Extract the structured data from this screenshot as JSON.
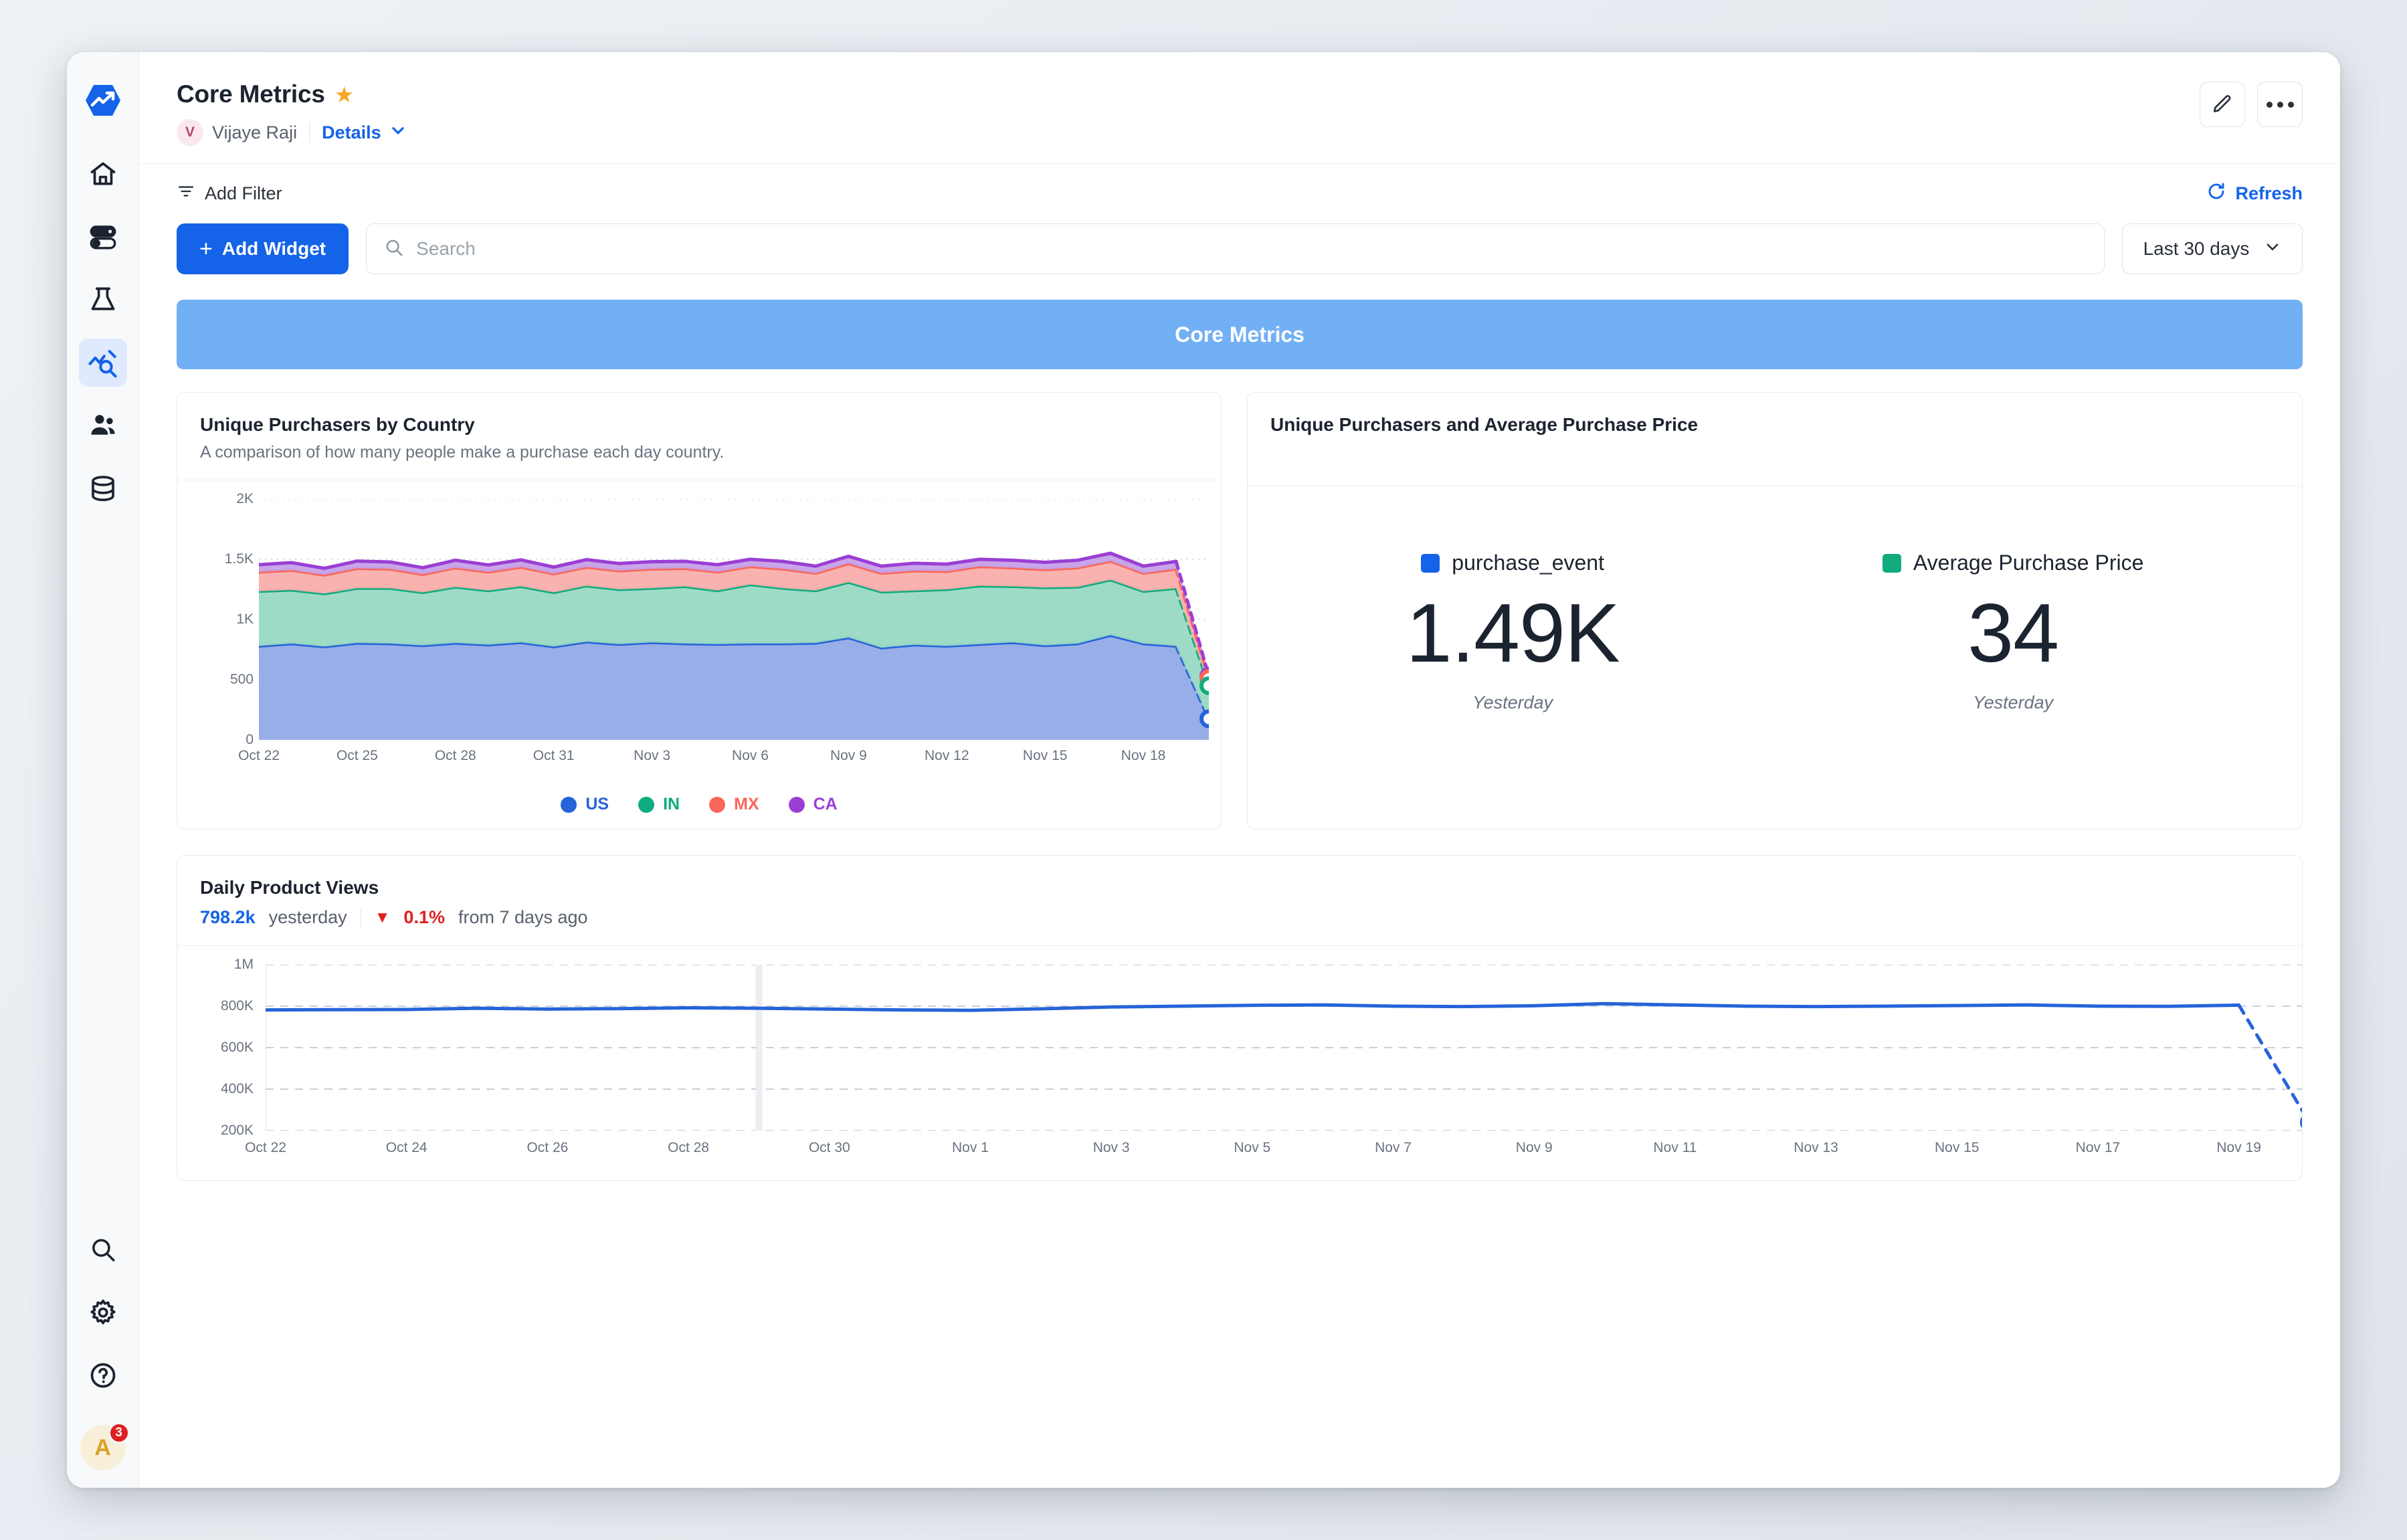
{
  "sidebar": {
    "items": [
      {
        "name": "logo",
        "icon": "statsig-logo-icon",
        "label": "Statsig"
      },
      {
        "name": "home",
        "icon": "home-icon",
        "label": "Home"
      },
      {
        "name": "feature-gates",
        "icon": "toggles-icon",
        "label": "Feature Gates"
      },
      {
        "name": "experiments",
        "icon": "flask-icon",
        "label": "Experiments"
      },
      {
        "name": "metrics",
        "icon": "analytics-icon",
        "label": "Metrics"
      },
      {
        "name": "audiences",
        "icon": "people-icon",
        "label": "Audiences"
      },
      {
        "name": "data",
        "icon": "database-icon",
        "label": "Data"
      }
    ],
    "bottom_items": [
      {
        "name": "search",
        "icon": "search-icon",
        "label": "Search"
      },
      {
        "name": "settings",
        "icon": "gear-icon",
        "label": "Settings"
      },
      {
        "name": "help",
        "icon": "question-circle-icon",
        "label": "Help"
      }
    ],
    "avatar": {
      "initial": "A",
      "badge_count": "3"
    }
  },
  "header": {
    "title": "Core Metrics",
    "starred_icon": "star-icon",
    "owner": {
      "initial": "V",
      "name": "Vijaye Raji"
    },
    "details_label": "Details",
    "edit_icon": "pencil-icon",
    "more_icon": "ellipsis-icon"
  },
  "toolbar": {
    "add_filter_label": "Add Filter",
    "filter_icon": "filter-icon",
    "refresh_label": "Refresh",
    "refresh_icon": "refresh-icon",
    "add_widget_label": "Add Widget",
    "add_widget_plus": "+",
    "search": {
      "value": "",
      "placeholder": "Search",
      "icon": "search-icon"
    },
    "date_range": {
      "value": "Last 30 days",
      "caret": "chevron-down-icon"
    }
  },
  "section": {
    "banner_title": "Core Metrics",
    "banner_color": "#72b0f5"
  },
  "cards": {
    "purchasers_by_country": {
      "title": "Unique Purchasers by Country",
      "subtitle": "A comparison of how many people make a purchase each day country."
    },
    "kpis": {
      "title": "Unique Purchasers and Average Purchase Price",
      "items": [
        {
          "color": "#1463e8",
          "name": "purchase_event",
          "value": "1.49K",
          "sub": "Yesterday"
        },
        {
          "color": "#10ab7e",
          "name": "Average Purchase Price",
          "value": "34",
          "sub": "Yesterday"
        }
      ]
    },
    "daily_product_views": {
      "title": "Daily Product Views",
      "value": "798.2k",
      "value_suffix": "yesterday",
      "trend_caret": "▼",
      "trend_pct": "0.1%",
      "trend_text": "from 7 days ago"
    }
  },
  "chart_data": [
    {
      "type": "area",
      "stacked": true,
      "title": "Unique Purchasers by Country",
      "subtitle": "A comparison of how many people make a purchase each day country.",
      "xlabel": "",
      "ylabel": "",
      "ylim": [
        0,
        2000
      ],
      "yticks": [
        "0",
        "500",
        "1K",
        "1.5K",
        "2K"
      ],
      "ytick_values": [
        0,
        500,
        1000,
        1500,
        2000
      ],
      "xticks": [
        "Oct 22",
        "Oct 25",
        "Oct 28",
        "Oct 31",
        "Nov 3",
        "Nov 6",
        "Nov 9",
        "Nov 12",
        "Nov 15",
        "Nov 18"
      ],
      "grid": true,
      "legend": "bottom",
      "x": [
        "Oct 22",
        "Oct 23",
        "Oct 24",
        "Oct 25",
        "Oct 26",
        "Oct 27",
        "Oct 28",
        "Oct 29",
        "Oct 30",
        "Oct 31",
        "Nov 1",
        "Nov 2",
        "Nov 3",
        "Nov 4",
        "Nov 5",
        "Nov 6",
        "Nov 7",
        "Nov 8",
        "Nov 9",
        "Nov 10",
        "Nov 11",
        "Nov 12",
        "Nov 13",
        "Nov 14",
        "Nov 15",
        "Nov 16",
        "Nov 17",
        "Nov 18",
        "Nov 19",
        "Nov 20"
      ],
      "series": [
        {
          "name": "US",
          "color": "#2563d9",
          "fill": "#92aae8",
          "values": [
            780,
            800,
            775,
            805,
            800,
            785,
            805,
            790,
            810,
            775,
            815,
            795,
            810,
            800,
            795,
            800,
            800,
            805,
            850,
            765,
            790,
            780,
            795,
            810,
            785,
            800,
            870,
            800,
            780,
            175
          ]
        },
        {
          "name": "IN",
          "color": "#10ab7e",
          "fill": "#99d9c3",
          "values": [
            455,
            445,
            440,
            455,
            460,
            440,
            465,
            450,
            465,
            450,
            465,
            455,
            450,
            475,
            445,
            490,
            460,
            435,
            460,
            465,
            450,
            470,
            485,
            465,
            480,
            470,
            460,
            435,
            480,
            275
          ]
        },
        {
          "name": "MX",
          "color": "#fa6659",
          "fill": "#f9aeab",
          "values": [
            160,
            165,
            155,
            165,
            160,
            150,
            160,
            155,
            160,
            155,
            155,
            155,
            160,
            150,
            155,
            150,
            160,
            145,
            155,
            155,
            165,
            150,
            160,
            155,
            150,
            160,
            155,
            150,
            160,
            60
          ]
        },
        {
          "name": "CA",
          "color": "#9b3fd4",
          "fill": "#c6a0e8",
          "values": [
            60,
            62,
            55,
            60,
            58,
            55,
            62,
            58,
            60,
            55,
            62,
            60,
            60,
            58,
            60,
            60,
            62,
            58,
            60,
            58,
            62,
            60,
            60,
            62,
            60,
            62,
            65,
            58,
            62,
            20
          ]
        }
      ],
      "projection_note": "last point dashed (partial day)"
    },
    {
      "type": "line",
      "title": "Daily Product Views",
      "ylim": [
        200000,
        1000000
      ],
      "yticks": [
        "200K",
        "400K",
        "600K",
        "800K",
        "1M"
      ],
      "ytick_values": [
        200000,
        400000,
        600000,
        800000,
        1000000
      ],
      "xticks": [
        "Oct 22",
        "Oct 24",
        "Oct 26",
        "Oct 28",
        "Oct 30",
        "Nov 1",
        "Nov 3",
        "Nov 5",
        "Nov 7",
        "Nov 9",
        "Nov 11",
        "Nov 13",
        "Nov 15",
        "Nov 17",
        "Nov 19"
      ],
      "grid": true,
      "legend": "none",
      "x": [
        "Oct 22",
        "Oct 23",
        "Oct 24",
        "Oct 25",
        "Oct 26",
        "Oct 27",
        "Oct 28",
        "Oct 29",
        "Oct 30",
        "Oct 31",
        "Nov 1",
        "Nov 2",
        "Nov 3",
        "Nov 4",
        "Nov 5",
        "Nov 6",
        "Nov 7",
        "Nov 8",
        "Nov 9",
        "Nov 10",
        "Nov 11",
        "Nov 12",
        "Nov 13",
        "Nov 14",
        "Nov 15",
        "Nov 16",
        "Nov 17",
        "Nov 18",
        "Nov 19",
        "Nov 20"
      ],
      "series": [
        {
          "name": "Product Views",
          "color": "#2563d9",
          "values": [
            782000,
            783000,
            784000,
            790000,
            786000,
            788000,
            792000,
            790000,
            786000,
            782000,
            780000,
            787000,
            796000,
            800000,
            804000,
            806000,
            800000,
            798000,
            802000,
            812000,
            806000,
            800000,
            798000,
            800000,
            803000,
            806000,
            800000,
            799000,
            805000,
            240000
          ]
        }
      ],
      "projection_note": "last segment dashed (partial day)"
    }
  ]
}
